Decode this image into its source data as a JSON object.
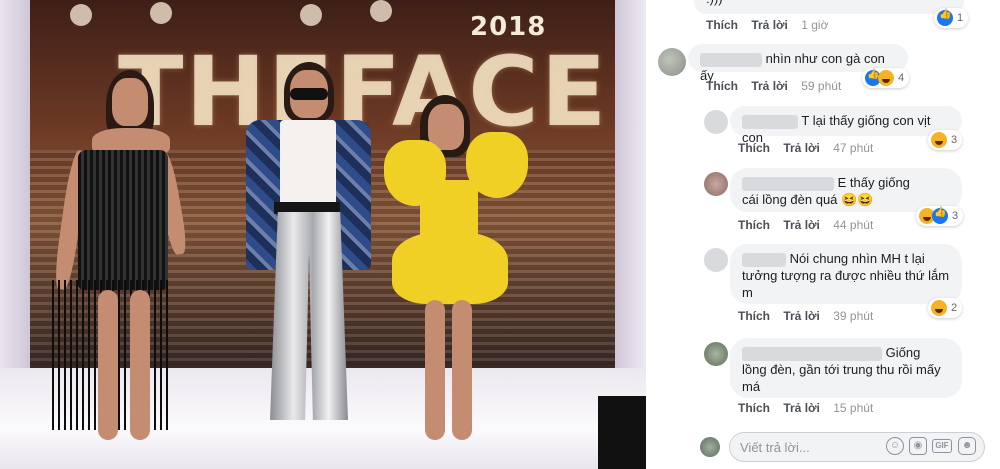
{
  "photo": {
    "logo_year": "2018",
    "logo_text": "THEFACE"
  },
  "comments": [
    {
      "text": ":)))",
      "actions": {
        "like": "Thích",
        "reply": "Trả lời"
      },
      "time": "1 giờ",
      "reactions": {
        "types": [
          "like-icon"
        ],
        "count": "1"
      }
    },
    {
      "text": "nhìn như con gà con ấy",
      "actions": {
        "like": "Thích",
        "reply": "Trả lời"
      },
      "time": "59 phút",
      "reactions": {
        "types": [
          "like-icon",
          "haha-icon"
        ],
        "count": "4"
      }
    },
    {
      "text": "T lại thấy giống con vịt con",
      "actions": {
        "like": "Thích",
        "reply": "Trả lời"
      },
      "time": "47 phút",
      "reactions": {
        "types": [
          "haha-icon"
        ],
        "count": "3"
      }
    },
    {
      "text_line1": "E thấy giống",
      "text_line2": "cái lồng đèn quá 😆😆",
      "actions": {
        "like": "Thích",
        "reply": "Trả lời"
      },
      "time": "44 phút",
      "reactions": {
        "types": [
          "haha-icon",
          "like-icon"
        ],
        "count": "3"
      }
    },
    {
      "text_line1": "Nói chung nhìn MH t lại",
      "text_line2": "tưởng tượng ra được nhiều thứ lắm",
      "text_line3": "m",
      "actions": {
        "like": "Thích",
        "reply": "Trả lời"
      },
      "time": "39 phút",
      "reactions": {
        "types": [
          "haha-icon"
        ],
        "count": "2"
      }
    },
    {
      "text_line1": "Giống",
      "text_line2": "lồng đèn, gần tới trung thu rồi mấy",
      "text_line3": "má",
      "actions": {
        "like": "Thích",
        "reply": "Trả lời"
      },
      "time": "15 phút"
    }
  ],
  "reply_input": {
    "placeholder": "Viết trả lời..."
  },
  "reply_tools": {
    "emoji": "emoji-icon",
    "camera": "camera-icon",
    "gif_label": "GIF",
    "sticker": "sticker-icon"
  },
  "colors": {
    "bubble_bg": "#f2f3f5",
    "meta_text": "#606770",
    "like_blue": "#1877f2",
    "haha_yellow": "#f7b125",
    "dress_yellow": "#f0d024"
  }
}
